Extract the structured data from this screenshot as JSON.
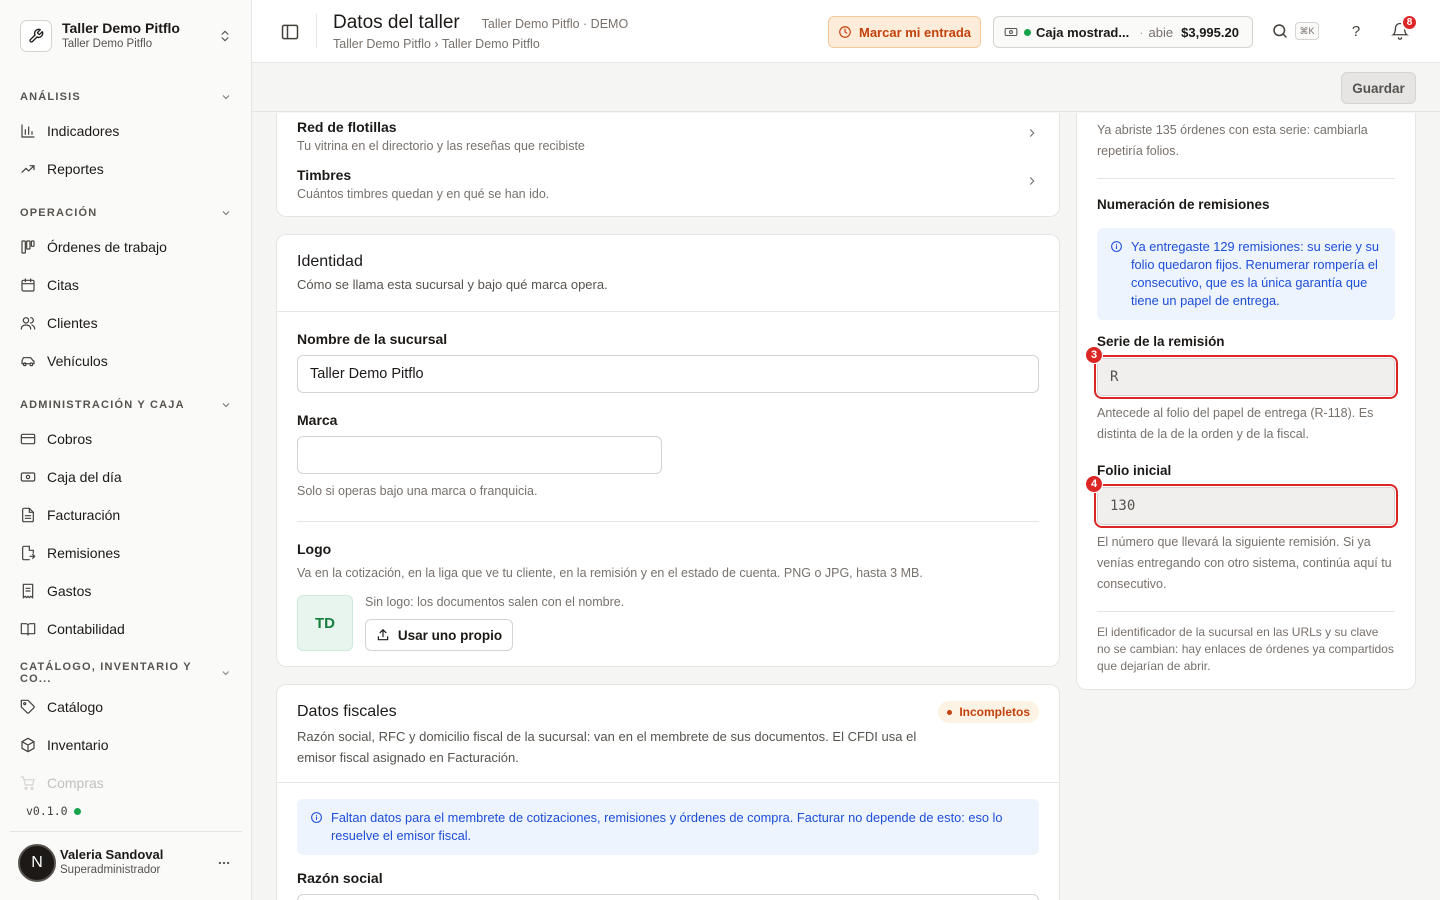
{
  "workspace": {
    "name": "Taller Demo Pitflo",
    "subtitle": "Taller Demo Pitflo"
  },
  "sidebar": {
    "sections": [
      {
        "title": "ANÁLISIS",
        "items": [
          "Indicadores",
          "Reportes"
        ]
      },
      {
        "title": "OPERACIÓN",
        "items": [
          "Órdenes de trabajo",
          "Citas",
          "Clientes",
          "Vehículos"
        ]
      },
      {
        "title": "ADMINISTRACIÓN Y CAJA",
        "items": [
          "Cobros",
          "Caja del día",
          "Facturación",
          "Remisiones",
          "Gastos",
          "Contabilidad"
        ]
      },
      {
        "title": "CATÁLOGO, INVENTARIO Y CO...",
        "items": [
          "Catálogo",
          "Inventario",
          "Compras"
        ]
      }
    ],
    "version": "v0.1.0",
    "user": {
      "initial": "N",
      "name": "Valeria Sandoval",
      "role": "Superadministrador"
    }
  },
  "header": {
    "title": "Datos del taller",
    "meta": "Taller Demo Pitflo · DEMO",
    "breadcrumb": "Taller Demo Pitflo › Taller Demo Pitflo",
    "checkin_label": "Marcar mi entrada",
    "register": {
      "name": "Caja mostrad...",
      "status": "abie",
      "amount": "$3,995.20"
    },
    "search_shortcut": "⌘K",
    "help": "?",
    "notifications": "8"
  },
  "actionbar": {
    "save_label": "Guardar"
  },
  "links": [
    {
      "title": "Red de flotillas",
      "desc": "Tu vitrina en el directorio y las reseñas que recibiste"
    },
    {
      "title": "Timbres",
      "desc": "Cuántos timbres quedan y en qué se han ido."
    }
  ],
  "identity": {
    "title": "Identidad",
    "desc": "Cómo se llama esta sucursal y bajo qué marca opera.",
    "branch_label": "Nombre de la sucursal",
    "branch_value": "Taller Demo Pitflo",
    "brand_label": "Marca",
    "brand_value": "",
    "brand_hint": "Solo si operas bajo una marca o franquicia.",
    "logo_label": "Logo",
    "logo_desc": "Va en la cotización, en la liga que ve tu cliente, en la remisión y en el estado de cuenta. PNG o JPG, hasta 3 MB.",
    "logo_initials": "TD",
    "logo_status": "Sin logo: los documentos salen con el nombre.",
    "upload_label": "Usar uno propio"
  },
  "fiscal": {
    "title": "Datos fiscales",
    "badge": "Incompletos",
    "desc": "Razón social, RFC y domicilio fiscal de la sucursal: van en el membrete de sus documentos. El CFDI usa el emisor fiscal asignado en Facturación.",
    "info": "Faltan datos para el membrete de cotizaciones, remisiones y órdenes de compra. Facturar no depende de esto: eso lo resuelve el emisor fiscal.",
    "razon_label": "Razón social"
  },
  "numbering": {
    "orders_note": "Ya abriste 135 órdenes con esta serie: cambiarla repetiría folios.",
    "remisiones_title": "Numeración de remisiones",
    "remisiones_info": "Ya entregaste 129 remisiones: su serie y su folio quedaron fijos. Renumerar rompería el consecutivo, que es la única garantía que tiene un papel de entrega.",
    "serie_label": "Serie de la remisión",
    "serie_value": "R",
    "serie_marker": "3",
    "serie_hint": "Antecede al folio del papel de entrega (R-118). Es distinta de la de la orden y de la fiscal.",
    "folio_label": "Folio inicial",
    "folio_value": "130",
    "folio_marker": "4",
    "folio_hint": "El número que llevará la siguiente remisión. Si ya venías entregando con otro sistema, continúa aquí tu consecutivo.",
    "footer_note": "El identificador de la sucursal en las URLs y su clave no se cambian: hay enlaces de órdenes ya compartidos que dejarían de abrir."
  },
  "colors": {
    "accent_orange": "#c2410c",
    "info_blue": "#1d4ed8",
    "danger": "#dc2626",
    "success": "#16a34a"
  }
}
